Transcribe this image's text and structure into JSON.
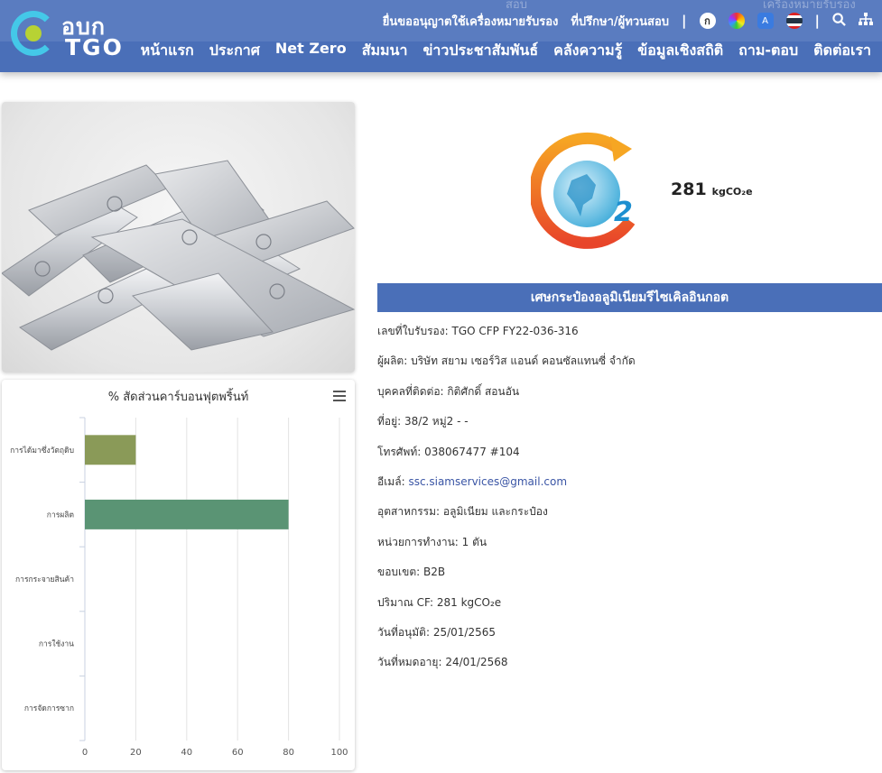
{
  "header": {
    "ghost_left": "สอบ",
    "ghost_right": "เครื่องหมายรับรอง",
    "logo_line1": "อบก",
    "logo_line2": "TGO",
    "top_links": [
      "ยื่นขออนุญาตใช้เครื่องหมายรับรอง",
      "ที่ปรึกษา/ผู้ทวนสอบ"
    ],
    "font_icon_label": "ก",
    "translate_icon_label": "A",
    "nav": [
      "หน้าแรก",
      "ประกาศ",
      "Net Zero",
      "สัมมนา",
      "ข่าวประชาสัมพันธ์",
      "คลังความรู้",
      "ข้อมูลเชิงสถิติ",
      "ถาม-ตอบ",
      "ติดต่อเรา"
    ]
  },
  "product": {
    "cf_value": "281",
    "cf_unit": "kgCO₂e",
    "title": "เศษกระป๋องอลูมิเนียมรีไซเคิลอินกอต",
    "info": [
      {
        "label": "เลขที่ใบรับรอง:",
        "value": "TGO CFP FY22-036-316"
      },
      {
        "label": "ผู้ผลิต:",
        "value": "บริษัท สยาม เซอร์วิส แอนด์ คอนซัลแทนซี่ จำกัด"
      },
      {
        "label": "บุคคลที่ติดต่อ:",
        "value": "กิติศักดิ์ สอนอัน"
      },
      {
        "label": "ที่อยู่:",
        "value": "38/2 หมู่2 - -"
      },
      {
        "label": "โทรศัพท์:",
        "value": "038067477 #104"
      },
      {
        "label": "อีเมล์:",
        "value": "ssc.siamservices@gmail.com"
      },
      {
        "label": "อุตสาหกรรม:",
        "value": "อลูมิเนียม และกระป๋อง"
      },
      {
        "label": "หน่วยการทำงาน:",
        "value": "1 ตัน"
      },
      {
        "label": "ขอบเขต:",
        "value": "B2B"
      },
      {
        "label": "ปริมาณ CF:",
        "value": "281 kgCO₂e"
      },
      {
        "label": "วันที่อนุมัติ:",
        "value": "25/01/2565"
      },
      {
        "label": "วันที่หมดอายุ:",
        "value": "24/01/2568"
      }
    ]
  },
  "chart_data": {
    "type": "bar",
    "orientation": "horizontal",
    "title": "% สัดส่วนคาร์บอนฟุตพริ้นท์",
    "categories": [
      "การได้มาซึ่งวัตถุดิบ",
      "การผลิต",
      "การกระจายสินค้า",
      "การใช้งาน",
      "การจัดการซาก"
    ],
    "values": [
      20,
      80,
      0,
      0,
      0
    ],
    "colors": [
      "#8a9a58",
      "#5a9474",
      "#7fb3d5",
      "#c28a5c",
      "#9b7fbd"
    ],
    "xlim": [
      0,
      100
    ],
    "xticks": [
      "0",
      "20",
      "40",
      "60",
      "80",
      "100"
    ],
    "grid": true
  },
  "colors": {
    "header_bg": "#4a6fb8",
    "title_bar": "#4a6fb8",
    "link": "#3a55a5"
  }
}
